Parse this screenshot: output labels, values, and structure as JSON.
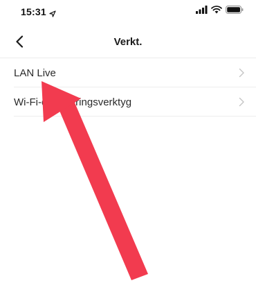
{
  "status_bar": {
    "time": "15:31",
    "icons": [
      "location-arrow-icon",
      "cellular-signal-icon",
      "wifi-icon",
      "battery-icon"
    ]
  },
  "nav": {
    "title": "Verkt.",
    "back_icon": "chevron-left-icon"
  },
  "list": {
    "items": [
      {
        "label": "LAN Live"
      },
      {
        "label": "Wi-Fi-detekteringsverktyg"
      }
    ]
  },
  "annotation": {
    "color": "#f23b4f"
  }
}
